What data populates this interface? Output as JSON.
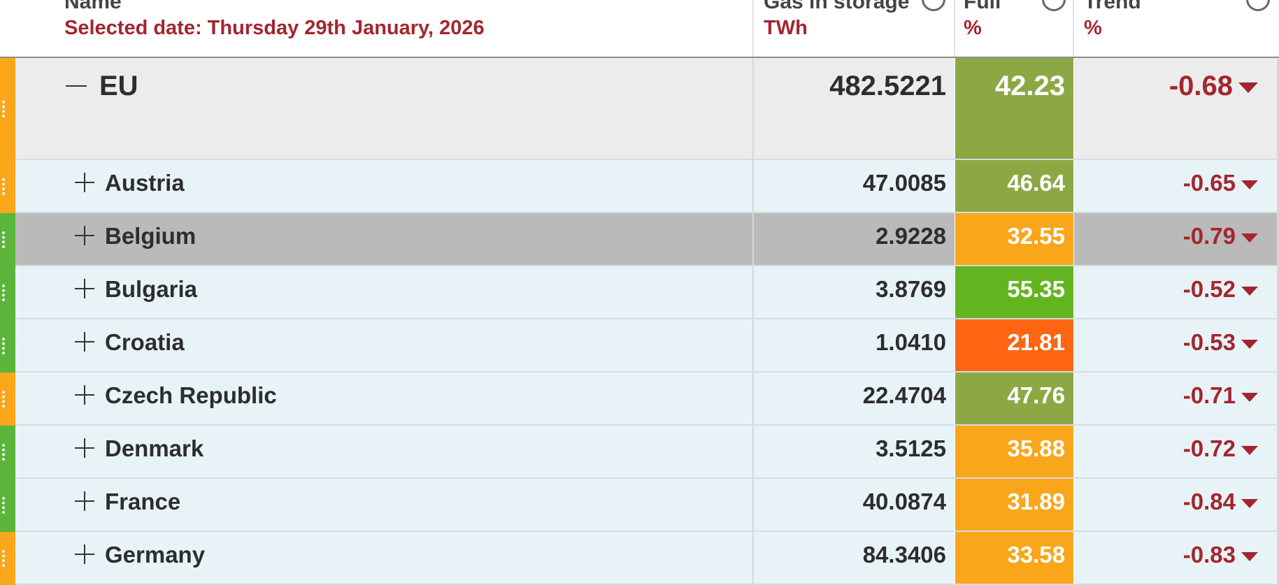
{
  "header": {
    "name_label": "Name",
    "selected_date": "Selected date: Thursday 29th January, 2026",
    "storage_label": "Gas in storage",
    "storage_unit": "TWh",
    "full_label": "Full",
    "full_unit": "%",
    "trend_label": "Trend",
    "trend_unit": "%"
  },
  "total": {
    "name": "EU",
    "storage": "482.5221",
    "full": "42.23",
    "trend": "-0.68",
    "full_color": "#8ca845",
    "edge_color": "#f9a61b"
  },
  "rows": [
    {
      "name": "Austria",
      "storage": "47.0085",
      "full": "46.64",
      "trend": "-0.65",
      "full_color": "#8ca845",
      "edge_color": "#f9a61b"
    },
    {
      "name": "Belgium",
      "storage": "2.9228",
      "full": "32.55",
      "trend": "-0.79",
      "full_color": "#f9a61b",
      "edge_color": "#5bb53b",
      "selected": true
    },
    {
      "name": "Bulgaria",
      "storage": "3.8769",
      "full": "55.35",
      "trend": "-0.52",
      "full_color": "#63b520",
      "edge_color": "#5bb53b"
    },
    {
      "name": "Croatia",
      "storage": "1.0410",
      "full": "21.81",
      "trend": "-0.53",
      "full_color": "#fd6512",
      "edge_color": "#5bb53b"
    },
    {
      "name": "Czech Republic",
      "storage": "22.4704",
      "full": "47.76",
      "trend": "-0.71",
      "full_color": "#8ca845",
      "edge_color": "#f9a61b"
    },
    {
      "name": "Denmark",
      "storage": "3.5125",
      "full": "35.88",
      "trend": "-0.72",
      "full_color": "#f9a61b",
      "edge_color": "#5bb53b"
    },
    {
      "name": "France",
      "storage": "40.0874",
      "full": "31.89",
      "trend": "-0.84",
      "full_color": "#f9a61b",
      "edge_color": "#5bb53b"
    },
    {
      "name": "Germany",
      "storage": "84.3406",
      "full": "33.58",
      "trend": "-0.83",
      "full_color": "#f9a61b",
      "edge_color": "#f9a61b"
    }
  ],
  "colors": {
    "header_subtitle": "#a3262e",
    "trend_down": "#a3262e",
    "row_bg": "#e8f3f8",
    "total_bg": "#ececec",
    "selected_bg": "#bababa"
  }
}
